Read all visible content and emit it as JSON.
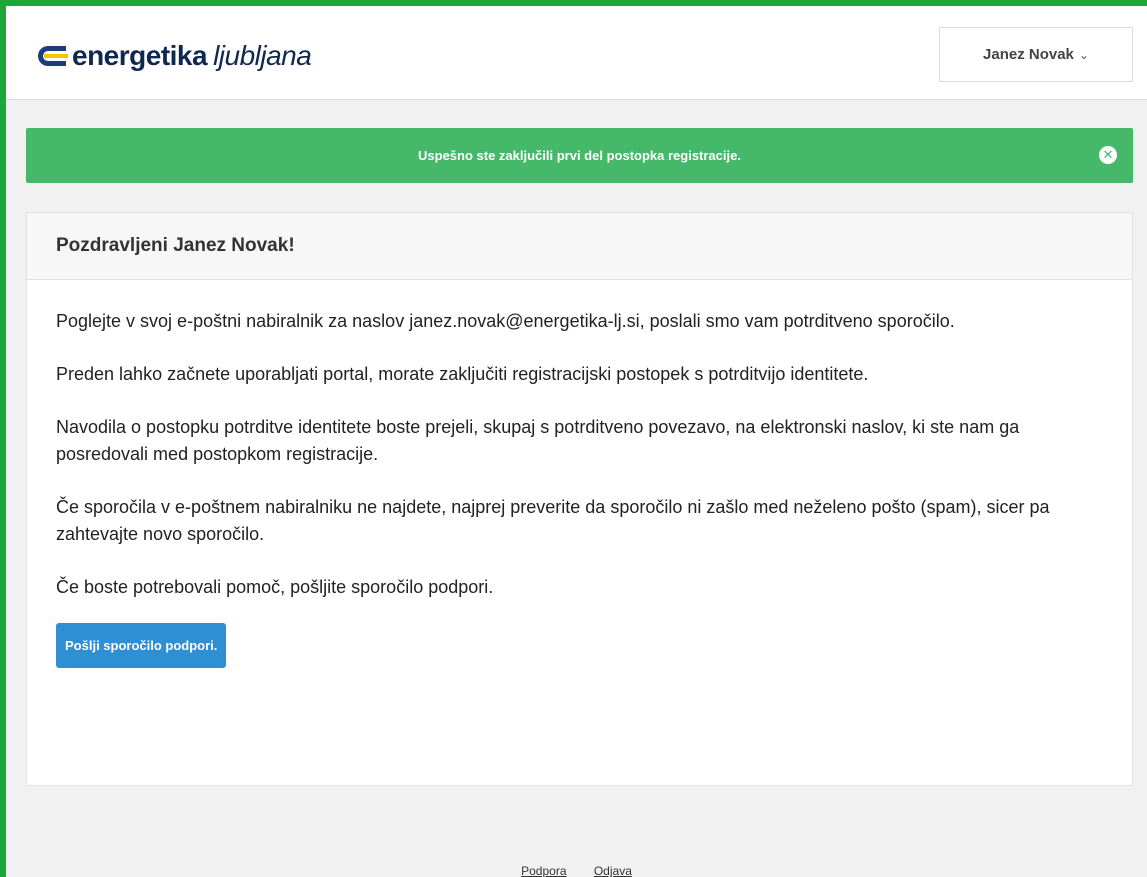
{
  "header": {
    "logo_bold": "energetika",
    "logo_light": "ljubljana",
    "user_name": "Janez Novak"
  },
  "alert": {
    "message": "Uspešno ste zaključili prvi del postopka registracije."
  },
  "card": {
    "title": "Pozdravljeni Janez Novak!",
    "paragraphs": [
      "Poglejte v svoj e-poštni nabiralnik za naslov janez.novak@energetika-lj.si, poslali smo vam potrditveno sporočilo.",
      "Preden lahko začnete uporabljati portal, morate zaključiti registracijski postopek s potrditvijo identitete.",
      "Navodila o postopku potrditve identitete boste prejeli, skupaj s potrditveno povezavo, na elektronski naslov, ki ste nam ga posredovali med postopkom registracije.",
      "Če sporočila v e-poštnem nabiralniku ne najdete, najprej preverite da sporočilo ni zašlo med neželeno pošto (spam), sicer pa zahtevajte novo sporočilo.",
      "Če boste potrebovali pomoč, pošljite sporočilo podpori."
    ],
    "button_label": "Pošlji sporočilo podpori."
  },
  "footer": {
    "links": [
      "Podpora",
      "Odjava"
    ]
  },
  "colors": {
    "frame": "#1fa63a",
    "success": "#46b86a",
    "primary_button": "#2f8fd4",
    "logo_text": "#10284f"
  }
}
